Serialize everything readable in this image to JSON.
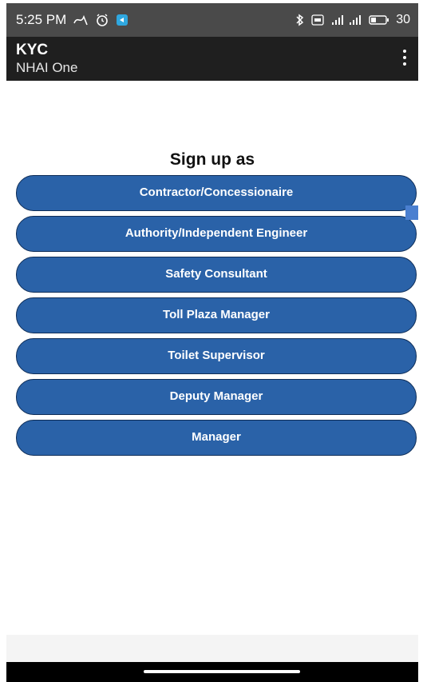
{
  "status_bar": {
    "time": "5:25 PM",
    "battery": "30",
    "left_icons": [
      "gesture-icon",
      "alarm-icon",
      "app-notification-icon"
    ],
    "right_icons": [
      "bluetooth-icon",
      "volte-icon",
      "signal-icon",
      "battery-icon"
    ]
  },
  "app_bar": {
    "title": "KYC",
    "subtitle": "NHAI One",
    "menu_icon": "more-vert-icon"
  },
  "main": {
    "heading": "Sign up as",
    "roles": [
      {
        "label": "Contractor/Concessionaire"
      },
      {
        "label": "Authority/Independent Engineer"
      },
      {
        "label": "Safety Consultant"
      },
      {
        "label": "Toll Plaza Manager"
      },
      {
        "label": "Toilet Supervisor"
      },
      {
        "label": "Deputy Manager"
      },
      {
        "label": "Manager"
      }
    ]
  },
  "colors": {
    "status_bar_bg": "#4a4a4a",
    "app_bar_bg": "#1f1f1f",
    "button_bg": "#2a62a8",
    "button_border": "#0e2d57"
  }
}
